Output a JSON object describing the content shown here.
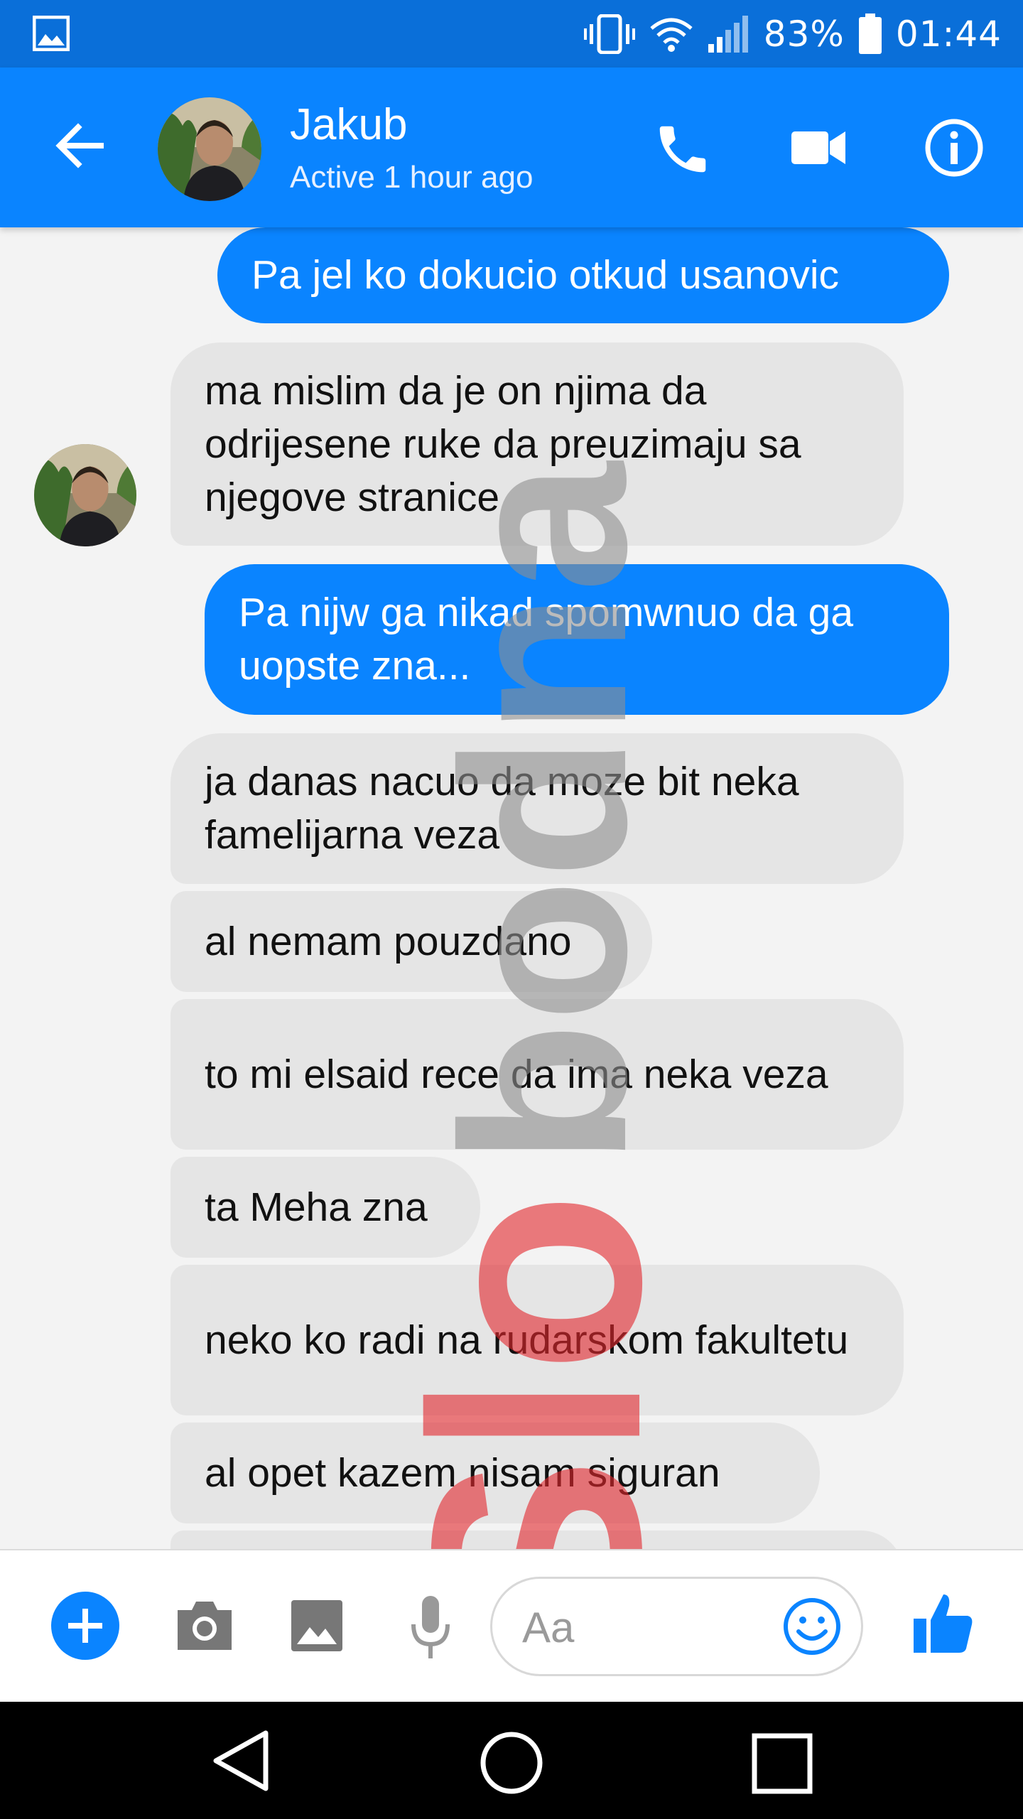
{
  "status_bar": {
    "battery_percent": "83%",
    "time": "01:44",
    "icons": [
      "gallery-icon",
      "vibrate-icon",
      "wifi-icon",
      "signal-icon",
      "battery-icon"
    ]
  },
  "header": {
    "contact_name": "Jakub",
    "status": "Active 1 hour ago",
    "icons": [
      "back-arrow-icon",
      "phone-icon",
      "video-camera-icon",
      "info-icon"
    ],
    "accent": "#0a84ff"
  },
  "messages": [
    {
      "direction": "out",
      "text": "Pa jel ko dokucio otkud usanovic"
    },
    {
      "direction": "in",
      "text": "ma mislim da je on njima da odrijesene ruke da preuzimaju sa njegove stranice"
    },
    {
      "direction": "out",
      "text": "Pa nijw ga nikad spomwnuo da ga uopste zna..."
    },
    {
      "direction": "in",
      "text": "ja danas nacuo da moze bit neka famelijarna veza"
    },
    {
      "direction": "in",
      "text": "al nemam pouzdano"
    },
    {
      "direction": "in",
      "text": "to mi elsaid rece da ima neka veza"
    },
    {
      "direction": "in",
      "text": "ta Meha zna"
    },
    {
      "direction": "in",
      "text": "neko ko radi na rudarskom fakultetu"
    },
    {
      "direction": "in",
      "text": "al opet kazem nisam siguran"
    }
  ],
  "watermark": {
    "text": "Slobodna Bosna"
  },
  "composer": {
    "placeholder": "Aa",
    "icons": [
      "plus-icon",
      "camera-icon",
      "image-icon",
      "microphone-icon",
      "emoji-icon",
      "thumbs-up-icon"
    ]
  },
  "nav_bar": {
    "icons": [
      "back-triangle-icon",
      "home-circle-icon",
      "recents-square-icon"
    ]
  },
  "colors": {
    "status_bar": "#0a6fd9",
    "header": "#0a84ff",
    "outgoing_bubble": "#0a84ff",
    "incoming_bubble": "#e5e5e5",
    "watermark_red": "#e3272d",
    "watermark_gray": "#9a9a9a"
  }
}
